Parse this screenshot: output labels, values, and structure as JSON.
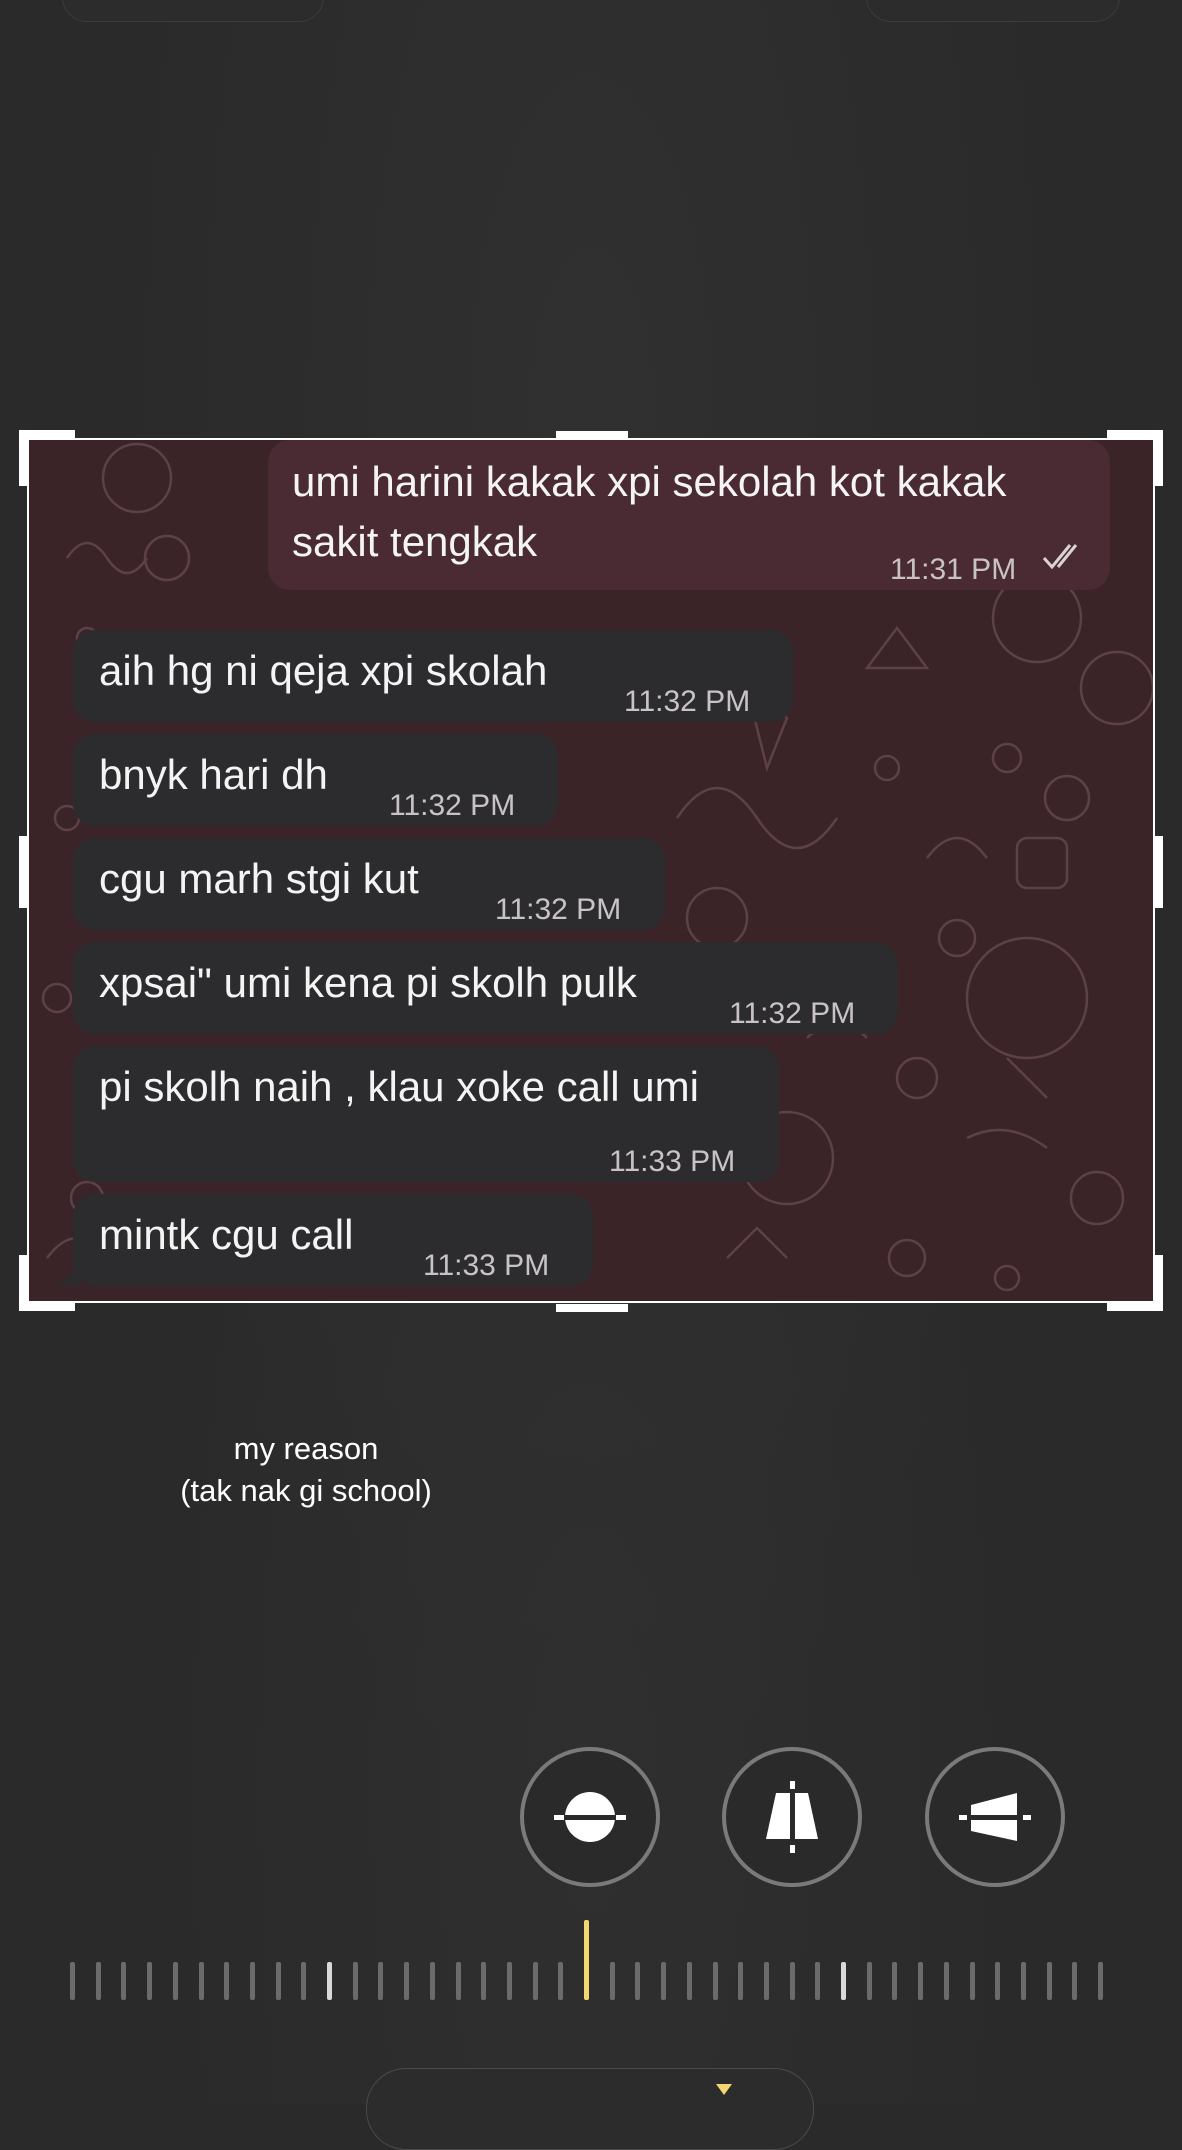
{
  "chat": {
    "messages": [
      {
        "direction": "outgoing",
        "text": "umi harini kakak xpi sekolah kot kakak\nsakit tengkak",
        "time": "11:31 PM",
        "status": "read"
      },
      {
        "direction": "incoming",
        "text": "aih hg ni qeja xpi skolah",
        "time": "11:32 PM"
      },
      {
        "direction": "incoming",
        "text": "bnyk hari dh",
        "time": "11:32 PM"
      },
      {
        "direction": "incoming",
        "text": "cgu marh stgi kut",
        "time": "11:32 PM"
      },
      {
        "direction": "incoming",
        "text": "xpsai\" umi kena pi skolh pulk",
        "time": "11:32 PM"
      },
      {
        "direction": "incoming",
        "text": "pi skolh naih , klau xoke call umi",
        "time": "11:33 PM"
      },
      {
        "direction": "incoming",
        "text": "mintk cgu call",
        "time": "11:33 PM"
      }
    ]
  },
  "caption": {
    "line1": "my reason",
    "line2": "(tak nak gi school)"
  },
  "tools": {
    "straighten_icon": "horizon-level-icon",
    "vertical_icon": "vertical-perspective-icon",
    "horizontal_icon": "horizontal-perspective-icon"
  },
  "colors": {
    "accent": "#f3d872",
    "outgoing_bubble": "#4a2a33",
    "incoming_bubble": "#2c2c2e",
    "chat_background": "#3a2428"
  }
}
